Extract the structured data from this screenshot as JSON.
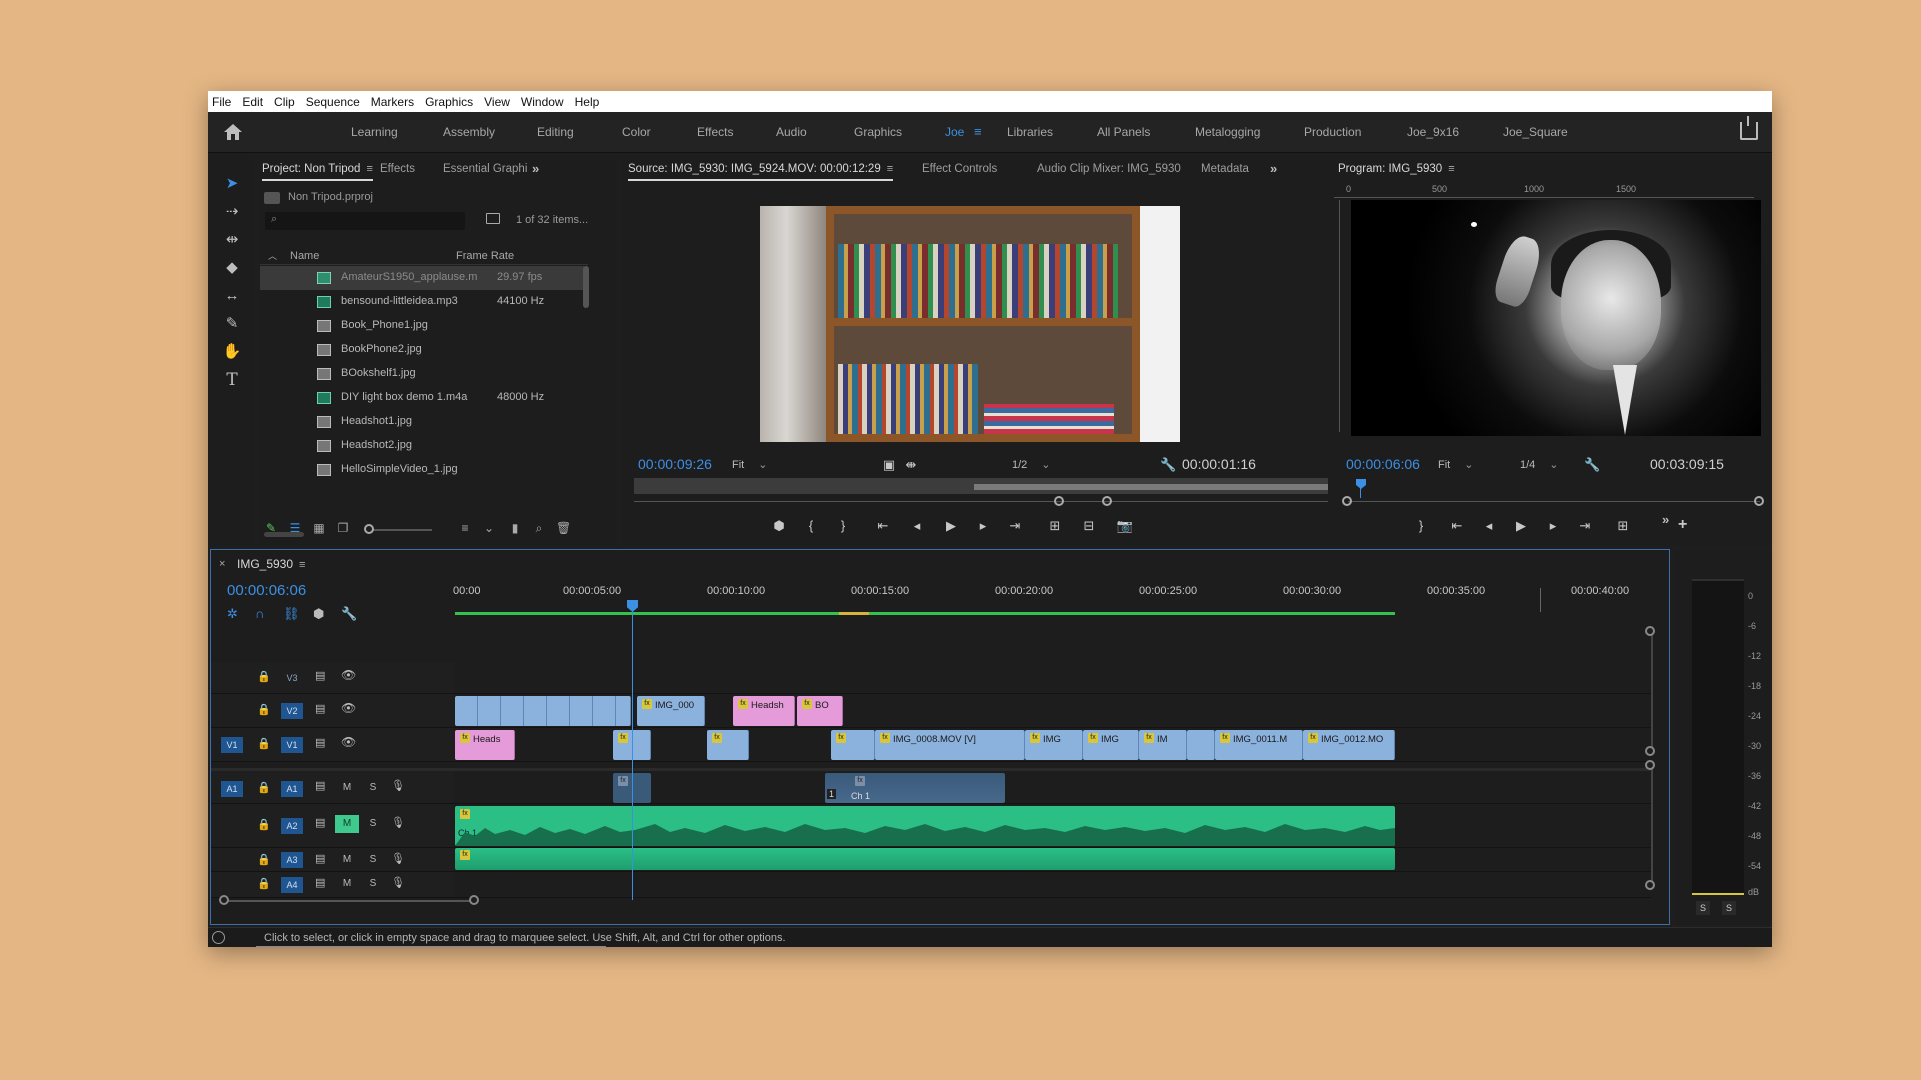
{
  "menubar": {
    "items": [
      "File",
      "Edit",
      "Clip",
      "Sequence",
      "Markers",
      "Graphics",
      "View",
      "Window",
      "Help"
    ]
  },
  "workspaces": {
    "tabs": [
      "Learning",
      "Assembly",
      "Editing",
      "Color",
      "Effects",
      "Audio",
      "Graphics",
      "Joe",
      "Libraries",
      "All Panels",
      "Metalogging",
      "Production",
      "Joe_9x16",
      "Joe_Square"
    ],
    "active": "Joe"
  },
  "project": {
    "tabs": [
      "Project: Non Tripod",
      "Effects",
      "Essential Graphi"
    ],
    "file": "Non Tripod.prproj",
    "items_count": "1 of 32 items...",
    "columns": [
      "Name",
      "Frame Rate"
    ],
    "rows": [
      {
        "name": "AmateurS1950_applause.m",
        "rate": "29.97 fps",
        "type": "av"
      },
      {
        "name": "bensound-littleidea.mp3",
        "rate": "44100 Hz",
        "type": "au"
      },
      {
        "name": "Book_Phone1.jpg",
        "rate": "",
        "type": "im"
      },
      {
        "name": "BookPhone2.jpg",
        "rate": "",
        "type": "im"
      },
      {
        "name": "BOokshelf1.jpg",
        "rate": "",
        "type": "im"
      },
      {
        "name": "DIY light box demo 1.m4a",
        "rate": "48000 Hz",
        "type": "au"
      },
      {
        "name": "Headshot1.jpg",
        "rate": "",
        "type": "im"
      },
      {
        "name": "Headshot2.jpg",
        "rate": "",
        "type": "im"
      },
      {
        "name": "HelloSimpleVideo_1.jpg",
        "rate": "",
        "type": "im"
      }
    ]
  },
  "source": {
    "tabs": [
      "Source: IMG_5930: IMG_5924.MOV: 00:00:12:29",
      "Effect Controls",
      "Audio Clip Mixer: IMG_5930",
      "Metadata"
    ],
    "timecode": "00:00:09:26",
    "fit": "Fit",
    "resolution": "1/2",
    "duration": "00:00:01:16"
  },
  "program": {
    "tab": "Program: IMG_5930",
    "ruler": [
      "0",
      "500",
      "1000",
      "1500"
    ],
    "timecode": "00:00:06:06",
    "fit": "Fit",
    "resolution": "1/4",
    "duration": "00:03:09:15"
  },
  "timeline": {
    "tab": "IMG_5930",
    "timecode": "00:00:06:06",
    "ruler": [
      "00:00",
      "00:00:05:00",
      "00:00:10:00",
      "00:00:15:00",
      "00:00:20:00",
      "00:00:25:00",
      "00:00:30:00",
      "00:00:35:00",
      "00:00:40:00"
    ],
    "tracks": {
      "v3": "V3",
      "v2": "V2",
      "v1": "V1",
      "v1src": "V1",
      "a1": "A1",
      "a1src": "A1",
      "a2": "A2",
      "a3": "A3",
      "a4": "A4"
    },
    "mute": "M",
    "solo": "S",
    "clips": {
      "v2_img000": "IMG_000",
      "v2_headsh": "Headsh",
      "v2_bo": "BO",
      "v1_heads": "Heads",
      "v1_img0008": "IMG_0008.MOV [V]",
      "v1_img_a": "IMG",
      "v1_img_b": "IMG",
      "v1_im": "IM",
      "v1_img0011": "IMG_0011.M",
      "v1_img0012": "IMG_0012.MO",
      "a1_num": "1",
      "a1_ch": "Ch 1",
      "a2_ch": "Ch 1"
    },
    "fx": "fx"
  },
  "meters": {
    "scale": [
      "0",
      "-6",
      "-12",
      "-18",
      "-24",
      "-30",
      "-36",
      "-42",
      "-48",
      "-54",
      "dB"
    ],
    "solo_left": "S",
    "solo_right": "S"
  },
  "status": {
    "text": "Click to select, or click in empty space and drag to marquee select. Use Shift, Alt, and Ctrl for other options."
  }
}
